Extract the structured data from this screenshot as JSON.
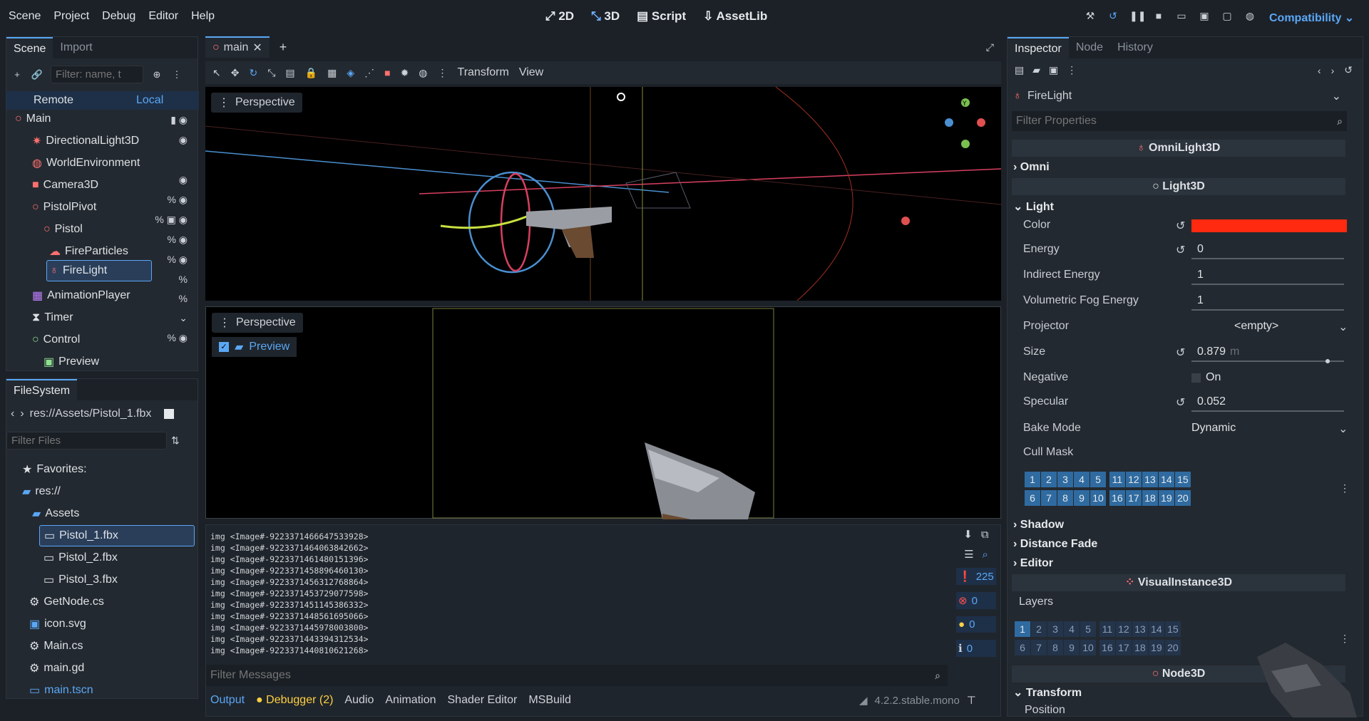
{
  "menu": [
    "Scene",
    "Project",
    "Debug",
    "Editor",
    "Help"
  ],
  "modes": [
    {
      "label": "2D",
      "icon": "2d-icon"
    },
    {
      "label": "3D",
      "icon": "3d-icon",
      "active": true
    },
    {
      "label": "Script",
      "icon": "script-icon"
    },
    {
      "label": "AssetLib",
      "icon": "assetlib-icon"
    }
  ],
  "renderer": "Compatibility",
  "scene_panel": {
    "tabs": [
      "Scene",
      "Import"
    ],
    "filter_placeholder": "Filter: name, t",
    "remote": "Remote",
    "local": "Local",
    "nodes": [
      {
        "name": "Main"
      },
      {
        "name": "DirectionalLight3D"
      },
      {
        "name": "WorldEnvironment"
      },
      {
        "name": "Camera3D"
      },
      {
        "name": "PistolPivot"
      },
      {
        "name": "Pistol"
      },
      {
        "name": "FireParticles"
      },
      {
        "name": "FireLight"
      },
      {
        "name": "AnimationPlayer"
      },
      {
        "name": "Timer"
      },
      {
        "name": "Control"
      },
      {
        "name": "Preview"
      }
    ]
  },
  "filesystem": {
    "title": "FileSystem",
    "path": "res://Assets/Pistol_1.fbx",
    "filter_placeholder": "Filter Files",
    "favorites": "Favorites:",
    "items": [
      "res://",
      "Assets",
      "Pistol_1.fbx",
      "Pistol_2.fbx",
      "Pistol_3.fbx",
      "GetNode.cs",
      "icon.svg",
      "Main.cs",
      "main.gd",
      "main.tscn"
    ]
  },
  "editor_tab": "main",
  "viewport_toolbar": {
    "transform": "Transform",
    "view": "View"
  },
  "viewports": [
    {
      "label": "Perspective"
    },
    {
      "label": "Perspective",
      "preview": "Preview"
    }
  ],
  "console": {
    "lines": [
      "img <Image#-9223371466647533928>",
      "img <Image#-9223371464063842662>",
      "img <Image#-9223371461480151396>",
      "img <Image#-9223371458896460130>",
      "img <Image#-9223371456312768864>",
      "img <Image#-9223371453729077598>",
      "img <Image#-9223371451145386332>",
      "img <Image#-9223371448561695066>",
      "img <Image#-9223371445978003800>",
      "img <Image#-9223371443394312534>",
      "img <Image#-9223371440810621268>"
    ],
    "counts": {
      "messages": "225",
      "errors": "0",
      "warnings": "0",
      "info": "0"
    },
    "filter_placeholder": "Filter Messages"
  },
  "bottom_tabs": [
    "Output",
    "Debugger (2)",
    "Audio",
    "Animation",
    "Shader Editor",
    "MSBuild"
  ],
  "version": "4.2.2.stable.mono",
  "inspector": {
    "tabs": [
      "Inspector",
      "Node",
      "History"
    ],
    "node_name": "FireLight",
    "filter_placeholder": "Filter Properties",
    "class": "OmniLight3D",
    "omni": "Omni",
    "light3d": "Light3D",
    "light": "Light",
    "props": [
      {
        "label": "Color",
        "value": "",
        "color": "#ff2a10"
      },
      {
        "label": "Energy",
        "value": "0"
      },
      {
        "label": "Indirect Energy",
        "value": "1"
      },
      {
        "label": "Volumetric Fog Energy",
        "value": "1"
      },
      {
        "label": "Projector",
        "value": "<empty>"
      },
      {
        "label": "Size",
        "value": "0.879",
        "unit": "m"
      },
      {
        "label": "Negative",
        "value": "On"
      },
      {
        "label": "Specular",
        "value": "0.052"
      },
      {
        "label": "Bake Mode",
        "value": "Dynamic"
      },
      {
        "label": "Cull Mask",
        "value": ""
      }
    ],
    "sections": [
      "Shadow",
      "Distance Fade",
      "Editor"
    ],
    "visual_instance": "VisualInstance3D",
    "layers": "Layers",
    "node3d": "Node3D",
    "transform": "Transform",
    "position": "Position"
  }
}
